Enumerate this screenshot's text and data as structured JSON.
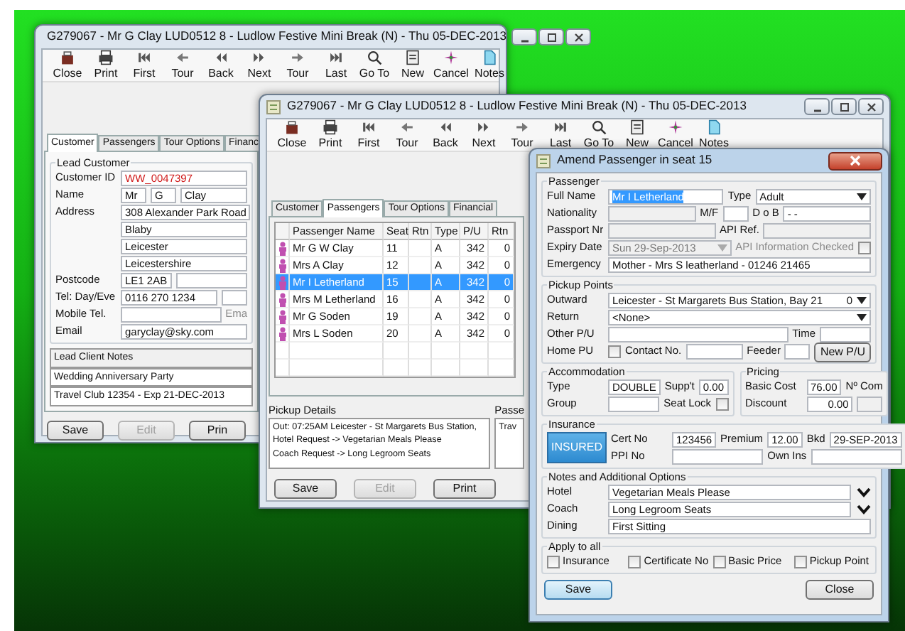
{
  "main_window": {
    "title": "G279067 - Mr G Clay  LUD0512  8 - Ludlow Festive Mini Break (N) - Thu 05-DEC-2013",
    "toolbar": [
      "Close",
      "Print",
      "First",
      "Tour",
      "Back",
      "Next",
      "Tour",
      "Last",
      "Go To",
      "New",
      "Cancel",
      "Notes"
    ],
    "tabs": [
      {
        "label": "Customer",
        "selected": true
      },
      {
        "label": "Passengers",
        "selected": false
      },
      {
        "label": "Tour Options",
        "selected": false
      },
      {
        "label": "Financ",
        "selected": false
      }
    ],
    "lead_customer": {
      "legend": "Lead Customer",
      "rows": [
        {
          "items": [
            {
              "kind": "label",
              "text": "Customer ID"
            },
            {
              "kind": "code",
              "value": "WW_0047397"
            }
          ]
        },
        {
          "items": [
            {
              "kind": "label",
              "text": "Name"
            },
            {
              "kind": "small",
              "value": "Mr"
            },
            {
              "kind": "small",
              "value": "G"
            },
            {
              "kind": "field",
              "value": "Clay"
            }
          ]
        },
        {
          "items": [
            {
              "kind": "label",
              "text": "Address"
            },
            {
              "kind": "field",
              "value": "308 Alexander Park Road"
            }
          ]
        },
        {
          "items": [
            {
              "kind": "spacer"
            },
            {
              "kind": "field",
              "value": "Blaby"
            }
          ]
        },
        {
          "items": [
            {
              "kind": "spacer"
            },
            {
              "kind": "field",
              "value": "Leicester"
            }
          ]
        },
        {
          "items": [
            {
              "kind": "spacer"
            },
            {
              "kind": "field",
              "value": "Leicestershire"
            }
          ]
        },
        {
          "items": [
            {
              "kind": "label",
              "text": "Postcode"
            },
            {
              "kind": "short",
              "value": "LE1 2AB"
            },
            {
              "kind": "field"
            }
          ]
        },
        {
          "items": [
            {
              "kind": "label",
              "text": "Tel: Day/Eve"
            },
            {
              "kind": "field",
              "value": "0116 270 1234"
            },
            {
              "kind": "small"
            }
          ]
        },
        {
          "items": [
            {
              "kind": "label",
              "text": "Mobile Tel."
            },
            {
              "kind": "field"
            },
            {
              "kind": "label",
              "text": "Ema",
              "disabled": true
            }
          ]
        },
        {
          "items": [
            {
              "kind": "label",
              "text": "Email"
            },
            {
              "kind": "field",
              "value": "garyclay@sky.com"
            }
          ]
        }
      ]
    },
    "notes": {
      "title": "Lead Client Notes",
      "lines": [
        "Wedding Anniversary Party",
        "Travel Club 12354 - Exp 21-DEC-2013"
      ]
    },
    "buttons": [
      {
        "label": "Save",
        "disabled": false
      },
      {
        "label": "Edit",
        "disabled": true
      },
      {
        "label": "Prin",
        "disabled": false
      }
    ]
  },
  "booking_window": {
    "title": "G279067 - Mr G Clay  LUD0512  8 - Ludlow Festive Mini Break (N) - Thu 05-DEC-2013",
    "toolbar": [
      "Close",
      "Print",
      "First",
      "Tour",
      "Back",
      "Next",
      "Tour",
      "Last",
      "Go To",
      "New",
      "Cancel",
      "Notes"
    ],
    "tabs": [
      {
        "label": "Customer",
        "selected": false
      },
      {
        "label": "Passengers",
        "selected": true
      },
      {
        "label": "Tour Options",
        "selected": false
      },
      {
        "label": "Financial",
        "selected": false
      }
    ],
    "passengers": {
      "columns": [
        "Passenger Name",
        "Seat",
        "Rtn",
        "Type",
        "P/U",
        "Rtn"
      ],
      "rows": [
        {
          "name": "Mr G W Clay",
          "seat": "11",
          "type": "A",
          "pu": "342",
          "return_pu": "0",
          "selected": false
        },
        {
          "name": "Mrs A Clay",
          "seat": "12",
          "type": "A",
          "pu": "342",
          "return_pu": "0",
          "selected": false
        },
        {
          "name": "Mr I Letherland",
          "seat": "15",
          "type": "A",
          "pu": "342",
          "return_pu": "0",
          "selected": true
        },
        {
          "name": "Mrs M Letherland",
          "seat": "16",
          "type": "A",
          "pu": "342",
          "return_pu": "0",
          "selected": false
        },
        {
          "name": "Mr G Soden",
          "seat": "19",
          "type": "A",
          "pu": "342",
          "return_pu": "0",
          "selected": false
        },
        {
          "name": "Mrs L Soden",
          "seat": "20",
          "type": "A",
          "pu": "342",
          "return_pu": "0",
          "selected": false
        }
      ]
    },
    "pickup_details": {
      "label": "Pickup Details",
      "lines": [
        "Out: 07:25AM Leicester  -  St Margarets Bus Station,",
        "Hotel Request ->  Vegetarian Meals Please",
        "Coach Request ->  Long Legroom Seats"
      ]
    },
    "passenger_notes": {
      "label": "Passe",
      "text": "Trav"
    },
    "buttons": [
      {
        "label": "Save",
        "disabled": false
      },
      {
        "label": "Edit",
        "disabled": true
      },
      {
        "label": "Print",
        "disabled": false
      }
    ]
  },
  "dialog": {
    "title": "Amend Passenger in seat 15",
    "sections": [
      {
        "groups": [
          {
            "legend": "Passenger",
            "rows": [
              {
                "items": [
                  {
                    "kind": "label",
                    "text": "Full Name"
                  },
                  {
                    "kind": "field",
                    "value": "Mr I Letherland",
                    "highlighted": true
                  },
                  {
                    "kind": "label",
                    "text": "Type"
                  },
                  {
                    "kind": "select",
                    "value": "Adult"
                  }
                ]
              },
              {
                "items": [
                  {
                    "kind": "label",
                    "text": "Nationality"
                  },
                  {
                    "kind": "field",
                    "disabled": true
                  },
                  {
                    "kind": "label",
                    "text": "M/F"
                  },
                  {
                    "kind": "small"
                  },
                  {
                    "kind": "label",
                    "text": "D o B"
                  },
                  {
                    "kind": "field",
                    "value": "- -"
                  }
                ]
              },
              {
                "items": [
                  {
                    "kind": "label",
                    "text": "Passport Nr"
                  },
                  {
                    "kind": "field",
                    "disabled": true
                  },
                  {
                    "kind": "label",
                    "text": "API Ref."
                  },
                  {
                    "kind": "field",
                    "disabled": true
                  }
                ]
              },
              {
                "items": [
                  {
                    "kind": "label",
                    "text": "Expiry Date"
                  },
                  {
                    "kind": "date",
                    "value": "Sun  29-Sep-2013"
                  },
                  {
                    "kind": "label",
                    "text": "API Information Checked",
                    "disabled": true
                  },
                  {
                    "kind": "check",
                    "checked": false
                  }
                ]
              },
              {
                "items": [
                  {
                    "kind": "label",
                    "text": "Emergency"
                  },
                  {
                    "kind": "field",
                    "value": "Mother - Mrs S leatherland - 01246 21465"
                  }
                ]
              }
            ]
          }
        ]
      },
      {
        "groups": [
          {
            "legend": "Pickup Points",
            "rows": [
              {
                "items": [
                  {
                    "kind": "label",
                    "text": "Outward"
                  },
                  {
                    "kind": "select",
                    "value": "Leicester  -  St Margarets Bus Station, Bay 21",
                    "extra": "0"
                  }
                ]
              },
              {
                "items": [
                  {
                    "kind": "label",
                    "text": "Return"
                  },
                  {
                    "kind": "select",
                    "value": "<None>"
                  }
                ]
              },
              {
                "items": [
                  {
                    "kind": "label",
                    "text": "Other P/U"
                  },
                  {
                    "kind": "field"
                  },
                  {
                    "kind": "label",
                    "text": "Time"
                  },
                  {
                    "kind": "short"
                  }
                ]
              },
              {
                "items": [
                  {
                    "kind": "label",
                    "text": "Home PU"
                  },
                  {
                    "kind": "check",
                    "checked": false
                  },
                  {
                    "kind": "label",
                    "text": "Contact No."
                  },
                  {
                    "kind": "field"
                  },
                  {
                    "kind": "label",
                    "text": "Feeder"
                  },
                  {
                    "kind": "small"
                  },
                  {
                    "kind": "button",
                    "label": "New P/U"
                  }
                ]
              }
            ]
          }
        ]
      },
      {
        "groups": [
          {
            "legend": "Accommodation",
            "rows": [
              {
                "items": [
                  {
                    "kind": "label",
                    "text": "Type"
                  },
                  {
                    "kind": "field",
                    "value": "DOUBLE"
                  },
                  {
                    "kind": "label",
                    "text": "Supp't"
                  },
                  {
                    "kind": "number",
                    "value": "0.00"
                  }
                ]
              },
              {
                "items": [
                  {
                    "kind": "label",
                    "text": "Group"
                  },
                  {
                    "kind": "field"
                  },
                  {
                    "kind": "label",
                    "text": "Seat Lock"
                  },
                  {
                    "kind": "check",
                    "checked": false
                  }
                ]
              }
            ]
          },
          {
            "legend": "Pricing",
            "rows": [
              {
                "items": [
                  {
                    "kind": "label",
                    "text": "Basic Cost"
                  },
                  {
                    "kind": "number",
                    "value": "76.00"
                  },
                  {
                    "kind": "label",
                    "text": "Nº Com"
                  }
                ]
              },
              {
                "items": [
                  {
                    "kind": "label",
                    "text": "Discount"
                  },
                  {
                    "kind": "number",
                    "value": "0.00"
                  },
                  {
                    "kind": "small",
                    "disabled": true
                  }
                ]
              }
            ]
          }
        ]
      },
      {
        "groups": [
          {
            "legend": "Insurance",
            "badge": "INSURED",
            "rows": [
              {
                "items": [
                  {
                    "kind": "label",
                    "text": "Cert No"
                  },
                  {
                    "kind": "field",
                    "value": "123456"
                  },
                  {
                    "kind": "label",
                    "text": "Premium"
                  },
                  {
                    "kind": "number",
                    "value": "12.00"
                  },
                  {
                    "kind": "label",
                    "text": "Bkd"
                  },
                  {
                    "kind": "field",
                    "value": "29-SEP-2013"
                  }
                ]
              },
              {
                "items": [
                  {
                    "kind": "label",
                    "text": "PPI No"
                  },
                  {
                    "kind": "field"
                  },
                  {
                    "kind": "label",
                    "text": "Own Ins"
                  },
                  {
                    "kind": "field"
                  }
                ]
              }
            ]
          }
        ]
      },
      {
        "groups": [
          {
            "legend": "Notes and Additional Options",
            "rows": [
              {
                "items": [
                  {
                    "kind": "label",
                    "text": "Hotel"
                  },
                  {
                    "kind": "note",
                    "value": "Vegetarian Meals Please"
                  }
                ]
              },
              {
                "items": [
                  {
                    "kind": "label",
                    "text": "Coach"
                  },
                  {
                    "kind": "note",
                    "value": "Long Legroom Seats"
                  }
                ]
              },
              {
                "items": [
                  {
                    "kind": "label",
                    "text": "Dining"
                  },
                  {
                    "kind": "field",
                    "value": "First Sitting"
                  }
                ]
              }
            ]
          }
        ]
      },
      {
        "groups": [
          {
            "legend": "Apply to all",
            "rows": [
              {
                "items": [
                  {
                    "kind": "check",
                    "text": "Insurance",
                    "checked": false
                  },
                  {
                    "kind": "check",
                    "text": "Certificate No",
                    "checked": false
                  },
                  {
                    "kind": "check",
                    "text": "Basic Price",
                    "checked": false
                  },
                  {
                    "kind": "check",
                    "text": "Pickup Point",
                    "checked": false
                  }
                ]
              }
            ]
          }
        ]
      }
    ],
    "buttons": [
      {
        "label": "Save",
        "default": true
      },
      {
        "label": "Close",
        "default": false
      }
    ]
  }
}
